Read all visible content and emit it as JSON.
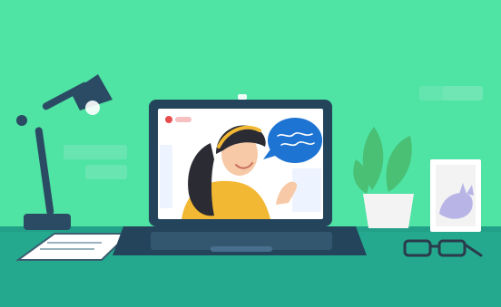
{
  "scene": {
    "colors": {
      "wall": "#4fe3a4",
      "desk": "#24a98f",
      "desk_edge": "#1f8f7a",
      "laptop_body": "#23445a",
      "screen_bg": "#ffffff",
      "shirt": "#f2b833",
      "skin": "#f7c9a6",
      "hair": "#2b2b33",
      "bubble": "#1e74d2",
      "plant": "#49c074",
      "pot": "#f3f3f3",
      "card": "#ffffff",
      "cat": "#b9b4e6",
      "glasses": "#2a3b4b",
      "lamp": "#2a4b63",
      "paper": "#ffffff",
      "decor": "#7fe7bd"
    },
    "icons": {
      "lamp": "desk-lamp-icon",
      "laptop": "laptop-icon",
      "video_call": "video-call-icon",
      "speech_bubble": "speech-bubble-icon",
      "plant": "potted-plant-icon",
      "frame": "picture-frame-icon",
      "cat": "cat-icon",
      "glasses": "glasses-icon",
      "notepad": "notepad-icon",
      "camera": "webcam-icon",
      "record": "record-dot-icon"
    }
  }
}
